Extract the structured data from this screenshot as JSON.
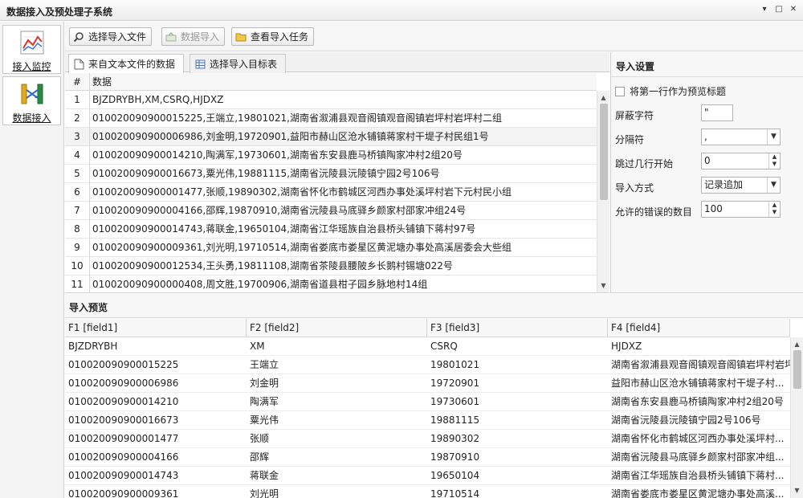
{
  "window": {
    "title": "数据接入及预处理子系统",
    "controls": [
      "▾",
      "□",
      "✕"
    ]
  },
  "nav": {
    "items": [
      {
        "label": "接入监控",
        "icon": "line-chart-icon"
      },
      {
        "label": "数据接入",
        "icon": "data-flow-icon"
      }
    ]
  },
  "toolbar": {
    "select_file": "选择导入文件",
    "data_import": "数据导入",
    "view_tasks": "查看导入任务"
  },
  "tabs": [
    {
      "label": "来自文本文件的数据",
      "active": true
    },
    {
      "label": "选择导入目标表",
      "active": false
    }
  ],
  "source_grid": {
    "col_num": "#",
    "col_data": "数据",
    "rows": [
      {
        "n": "1",
        "text": "BJZDRYBH,XM,CSRQ,HJDXZ"
      },
      {
        "n": "2",
        "text": "010020090900015225,王端立,19801021,湖南省溆浦县观音阁镇观音阁镇岩坪村岩坪村二组"
      },
      {
        "n": "3",
        "text": "010020090900006986,刘金明,19720901,益阳市赫山区沧水铺镇蒋家村干堤子村民组1号"
      },
      {
        "n": "4",
        "text": "010020090900014210,陶满军,19730601,湖南省东安县鹿马桥镇陶家冲村2组20号"
      },
      {
        "n": "5",
        "text": "010020090900016673,粟光伟,19881115,湖南省沅陵县沅陵镇宁园2号106号"
      },
      {
        "n": "6",
        "text": "010020090900001477,张顺,19890302,湖南省怀化市鹤城区河西办事处溪坪村岩下元村民小组"
      },
      {
        "n": "7",
        "text": "010020090900004166,邵辉,19870910,湖南省沅陵县马底驿乡颜家村邵家冲组24号"
      },
      {
        "n": "8",
        "text": "010020090900014743,蒋联金,19650104,湖南省江华瑶族自治县桥头铺镇下蒋村97号"
      },
      {
        "n": "9",
        "text": "010020090900009361,刘光明,19710514,湖南省娄底市娄星区黄泥塘办事处高溪居委会大些组"
      },
      {
        "n": "10",
        "text": "010020090900012534,王头勇,19811108,湖南省茶陵县腰陂乡长鹅村锡塘022号"
      },
      {
        "n": "11",
        "text": "010020090900000408,周文胜,19700906,湖南省道县柑子园乡脉地村14组"
      }
    ]
  },
  "settings": {
    "title": "导入设置",
    "first_row_header": "将第一行作为预览标题",
    "mask_char_label": "屏蔽字符",
    "mask_char_value": "\"",
    "delimiter_label": "分隔符",
    "delimiter_value": ",",
    "skip_rows_label": "跳过几行开始",
    "skip_rows_value": "0",
    "import_mode_label": "导入方式",
    "import_mode_value": "记录追加",
    "allowed_errors_label": "允许的错误的数目",
    "allowed_errors_value": "100"
  },
  "preview": {
    "title": "导入预览",
    "columns": [
      "F1 [field1]",
      "F2 [field2]",
      "F3 [field3]",
      "F4 [field4]"
    ],
    "rows": [
      [
        "BJZDRYBH",
        "XM",
        "CSRQ",
        "HJDXZ"
      ],
      [
        "010020090900015225",
        "王端立",
        "19801021",
        "湖南省溆浦县观音阁镇观音阁镇岩坪村岩坪村..."
      ],
      [
        "010020090900006986",
        "刘金明",
        "19720901",
        "益阳市赫山区沧水铺镇蒋家村干堤子村..."
      ],
      [
        "010020090900014210",
        "陶满军",
        "19730601",
        "湖南省东安县鹿马桥镇陶家冲村2组20号"
      ],
      [
        "010020090900016673",
        "粟光伟",
        "19881115",
        "湖南省沅陵县沅陵镇宁园2号106号"
      ],
      [
        "010020090900001477",
        "张顺",
        "19890302",
        "湖南省怀化市鹤城区河西办事处溪坪村..."
      ],
      [
        "010020090900004166",
        "邵辉",
        "19870910",
        "湖南省沅陵县马底驿乡颜家村邵家冲组..."
      ],
      [
        "010020090900014743",
        "蒋联金",
        "19650104",
        "湖南省江华瑶族自治县桥头铺镇下蒋村..."
      ],
      [
        "010020090900009361",
        "刘光明",
        "19710514",
        "湖南省娄底市娄星区黄泥塘办事处高溪..."
      ]
    ]
  }
}
